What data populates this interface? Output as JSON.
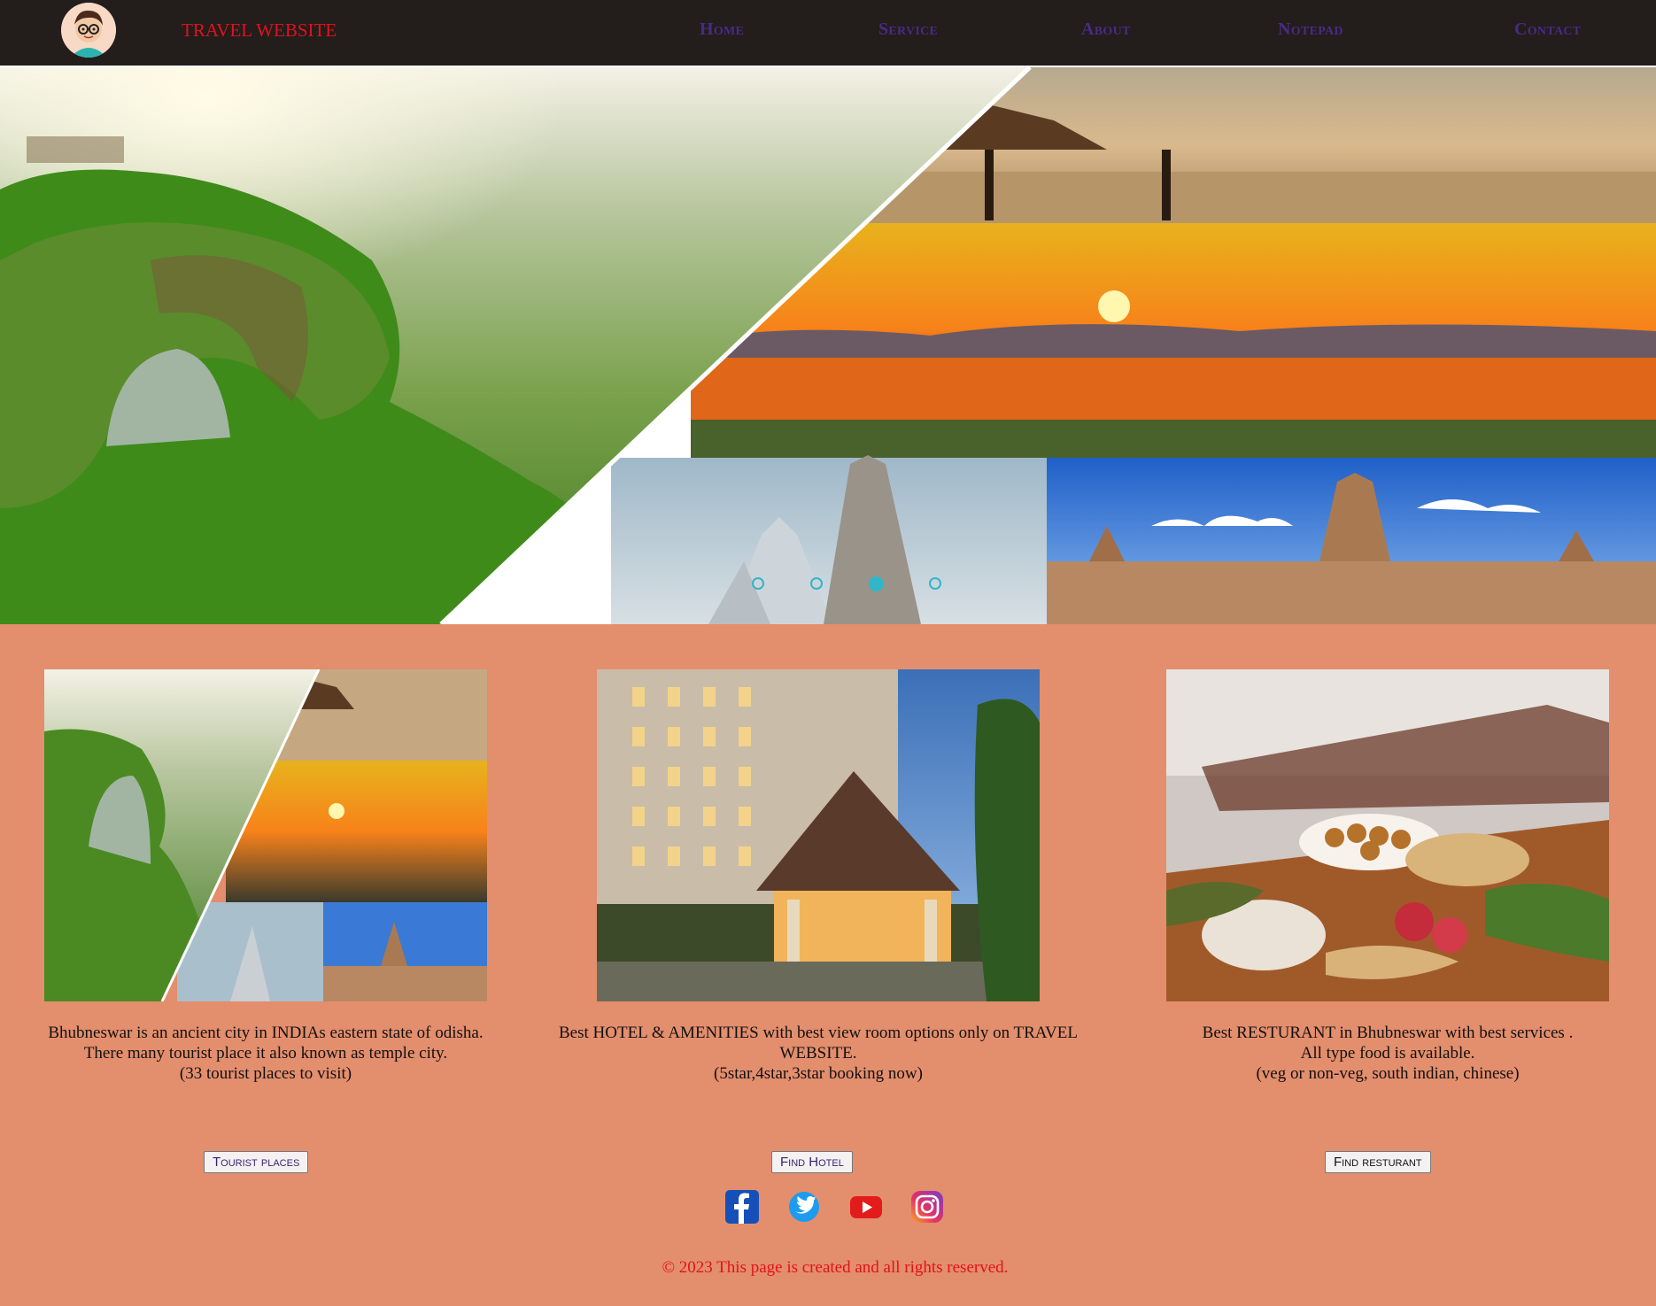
{
  "nav": {
    "brand": "TRAVEL WEBSITE",
    "links": [
      "Home",
      "Service",
      "About",
      "Notepad",
      "Contact"
    ]
  },
  "carousel": {
    "slides": 4,
    "active_index": 2
  },
  "cards": [
    {
      "lines": [
        "Bhubneswar is an ancient city in INDIAs eastern state of odisha.",
        "There many tourist place it also known as temple city.",
        "(33 tourist places to visit)"
      ],
      "button": "Tourist places"
    },
    {
      "lines": [
        "Best HOTEL & AMENITIES with best view room options only on TRAVEL WEBSITE.",
        "(5star,4star,3star booking now)"
      ],
      "button": "Find Hotel"
    },
    {
      "lines": [
        "Best RESTURANT in Bhubneswar with best services .",
        "All type food is available.",
        "(veg or non-veg, south indian, chinese)"
      ],
      "button": "Find resturant"
    }
  ],
  "social": [
    "facebook-icon",
    "twitter-icon",
    "youtube-icon",
    "instagram-icon"
  ],
  "footer": "© 2023 This page is created and all rights reserved.",
  "colors": {
    "nav_bg": "#231d1c",
    "page_bg": "#e38e6d",
    "brand": "#e0121b",
    "nav_link": "#4a2a86",
    "dot": "#31b6c8"
  }
}
